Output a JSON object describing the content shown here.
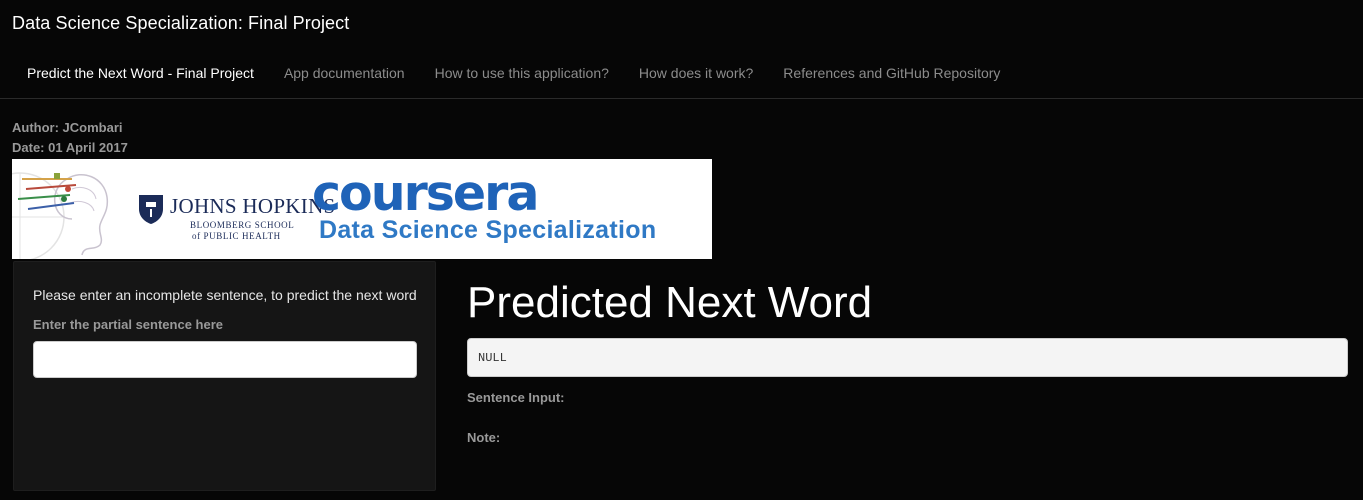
{
  "app": {
    "title": "Data Science Specialization: Final Project"
  },
  "tabs": [
    {
      "label": "Predict the Next Word - Final Project",
      "active": true
    },
    {
      "label": "App documentation",
      "active": false
    },
    {
      "label": "How to use this application?",
      "active": false
    },
    {
      "label": "How does it work?",
      "active": false
    },
    {
      "label": "References and GitHub Repository",
      "active": false
    }
  ],
  "meta": {
    "author": "Author: JCombari",
    "date": "Date: 01 April 2017"
  },
  "banner": {
    "jh_line1": "JOHNS HOPKINS",
    "jh_line2": "BLOOMBERG SCHOOL",
    "jh_line3": "of PUBLIC HEALTH",
    "coursera": "coursera",
    "specialization": "Data Science Specialization",
    "colors": {
      "coursera_blue": "#1f63b8",
      "jh_navy": "#1b2b58"
    },
    "icons": [
      "brain-network-image",
      "jhu-shield-logo"
    ]
  },
  "sidebar": {
    "instruction": "Please enter an incomplete sentence, to predict the next word",
    "input_label": "Enter the partial sentence here",
    "input_value": ""
  },
  "main": {
    "title": "Predicted Next Word",
    "output_value": "NULL",
    "sentence_input_label": "Sentence Input:",
    "note_label": "Note:"
  },
  "colors": {
    "background": "#060606",
    "panel": "#151515",
    "muted_text": "#999999"
  }
}
